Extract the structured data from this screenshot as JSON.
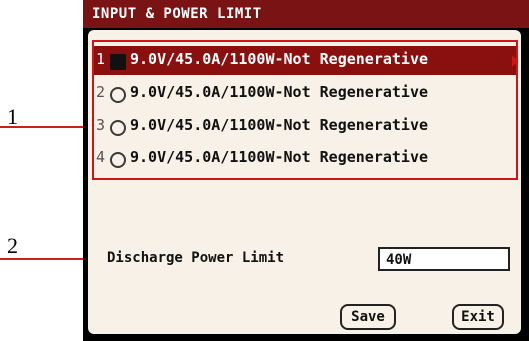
{
  "window": {
    "title": "INPUT & POWER LIMIT"
  },
  "colors": {
    "title_bar": "#7a1414",
    "panel": "#f7f1e7",
    "highlight": "#8a1010",
    "callout": "#cc1f1f"
  },
  "callouts": [
    "1",
    "2"
  ],
  "profiles": [
    {
      "index": "1",
      "label": "9.0V/45.0A/1100W-Not Regenerative",
      "selected": true
    },
    {
      "index": "2",
      "label": "9.0V/45.0A/1100W-Not Regenerative",
      "selected": false
    },
    {
      "index": "3",
      "label": "9.0V/45.0A/1100W-Not Regenerative",
      "selected": false
    },
    {
      "index": "4",
      "label": "9.0V/45.0A/1100W-Not Regenerative",
      "selected": false
    }
  ],
  "discharge": {
    "label": "Discharge Power Limit",
    "value": "40W"
  },
  "buttons": {
    "save": "Save",
    "exit": "Exit"
  }
}
